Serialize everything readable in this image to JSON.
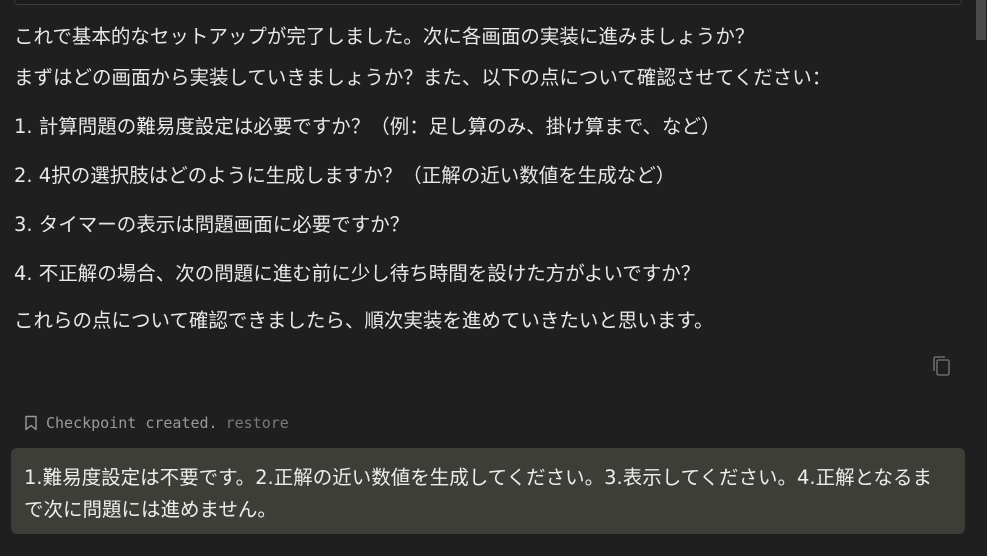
{
  "assistant_message": {
    "line1": "これで基本的なセットアップが完了しました。次に各画面の実装に進みましょうか？",
    "line2": "まずはどの画面から実装していきましょうか？また、以下の点について確認させてください：",
    "items": [
      "1. 計算問題の難易度設定は必要ですか？（例：足し算のみ、掛け算まで、など）",
      "2. 4択の選択肢はどのように生成しますか？（正解の近い数値を生成など）",
      "3. タイマーの表示は問題画面に必要ですか？",
      "4. 不正解の場合、次の問題に進む前に少し待ち時間を設けた方がよいですか？"
    ],
    "closing": "これらの点について確認できましたら、順次実装を進めていきたいと思います。",
    "copy_icon": "copy-icon"
  },
  "checkpoint": {
    "icon": "bookmark-icon",
    "text": "Checkpoint created.",
    "restore_label": "restore"
  },
  "user_message": {
    "text": "1.難易度設定は不要です。2.正解の近い数値を生成してください。3.表示してください。4.正解となるまで次に問題には進めません。"
  },
  "colors": {
    "background": "#1f1f1f",
    "user_bubble": "#3e3e38",
    "text": "#e8e8e8",
    "muted": "#9a9a9a"
  }
}
